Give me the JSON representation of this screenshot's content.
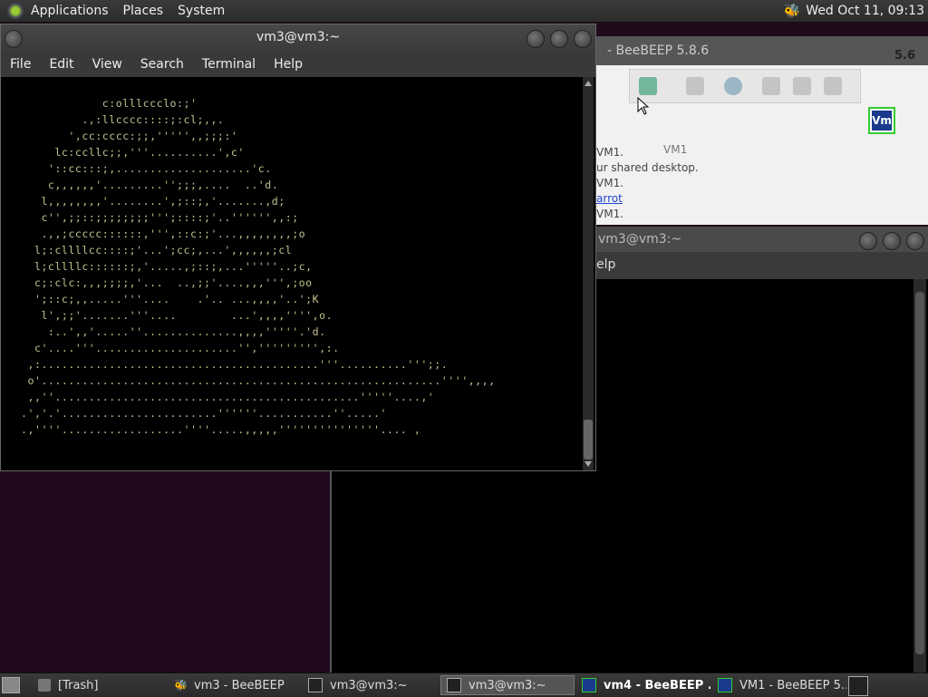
{
  "top_panel": {
    "menus": [
      "Applications",
      "Places",
      "System"
    ],
    "clock": "Wed Oct 11, 09:13"
  },
  "terminal_main": {
    "title": "vm3@vm3:~",
    "menu": [
      "File",
      "Edit",
      "View",
      "Search",
      "Terminal",
      "Help"
    ],
    "ascii_art": "            c:olllccclo:;'\n         .,:llcccc::::;:cl;,,.\n       ',cc:cccc:;;,''''',,;;;:'\n     lc:ccllc;;,'''..........',c'\n    '::cc:::;,....................'c.\n    c,,,,,,'.........'';;;,....  ..'d.\n   l,,,,,,,,'........',;::;,'.......,d;\n   c'',;;::;;;;;;;;''';::::;'..'''''',,:;\n   .,,;ccccc::::::,''',::c:;'...,,,,,,,,;o\n  l;:cllllcc::::;'...';cc;,...',,,,,,;cl\n  l;cllllc::::::;,'.....,;::;,...'''''..;c,\n  c;:clc:,,,;;;;,'...  ..,;;'....,,,''',;oo\n  ';::c;,,.....'''....    .'.. ...,,,,'..';K\n   l',;;'.......'''....        ...',,,,'''',o.\n    :..',,'.....''..............,,,,'''''.'d.\n  c'....'''.....................'',''''''''',:.\n ,:.........................................'''..........''';;.\n o'...........................................................'''',,,,\n ,,''.............................................'''''....,'\n.','.'.......................''''''...........''.....'\n.,''''..................''''.....,,,,,'''''''''''''''.... ,",
    "scrollbar_position": 0.88
  },
  "beebeep_window": {
    "title": "- BeeBEEP 5.8.6",
    "version_hint": "5.6",
    "user_entry": "VM1",
    "lines": [
      "VM1.",
      "ur shared desktop.",
      "VM1.",
      "arrot",
      "VM1."
    ],
    "vm_badge": "Vm"
  },
  "terminal_bg": {
    "title": "vm3@vm3:~",
    "menu_fragment": "elp"
  },
  "taskbar": {
    "items": [
      {
        "label": "[Trash]",
        "icon": "trash-icon"
      },
      {
        "label": "vm3 - BeeBEEP",
        "icon": "bee-icon"
      },
      {
        "label": "vm3@vm3:~",
        "icon": "terminal-icon"
      },
      {
        "label": "vm3@vm3:~",
        "icon": "terminal-icon",
        "active": true
      },
      {
        "label": "vm4 - BeeBEEP ...",
        "icon": "vm-icon",
        "bold": true
      },
      {
        "label": "VM1 - BeeBEEP 5....",
        "icon": "vm-icon"
      }
    ]
  },
  "colors": {
    "desktop": "#21091f",
    "terminal_bg": "#000000",
    "ascii_fg": "#c2c28e",
    "panel": "#2f2f2f"
  }
}
